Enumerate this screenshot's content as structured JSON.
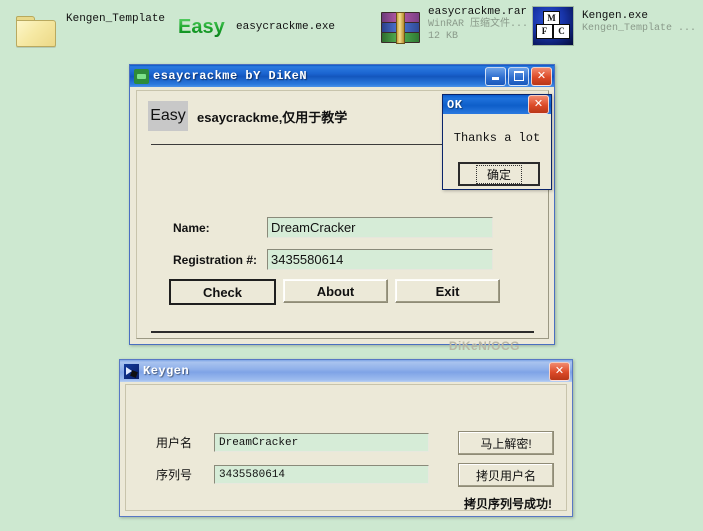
{
  "desktop": {
    "background_color": "#cde8d0",
    "icons": [
      {
        "id": "folder",
        "icon": "folder-icon",
        "title": "Kengen_Template",
        "subtitle": ""
      },
      {
        "id": "easycrackme",
        "icon": "easy-app-icon",
        "logo_text": "Easy",
        "title": "easycrackme.exe",
        "subtitle": ""
      },
      {
        "id": "rar",
        "icon": "winrar-archive-icon",
        "title": "easycrackme.rar",
        "subtitle": "WinRAR 压缩文件...",
        "subtitle2": "12 KB"
      },
      {
        "id": "kengen",
        "icon": "msvc-mfc-icon",
        "cubes": [
          "M",
          "F",
          "C"
        ],
        "title": "Kengen.exe",
        "subtitle": "Kengen_Template ..."
      }
    ]
  },
  "main_window": {
    "title": "esaycrackme bY DiKeN",
    "title_icon": "app-icon",
    "buttons": {
      "minimize": "_",
      "maximize": "□",
      "close": "✕"
    },
    "banner_badge": "Easy",
    "banner_text": "esaycrackme,仅用于教学",
    "fields": [
      {
        "label": "Name:",
        "value": "DreamCracker"
      },
      {
        "label": "Registration #:",
        "value": "3435580614"
      }
    ],
    "actions": [
      {
        "label": "Check",
        "focused": true
      },
      {
        "label": "About",
        "focused": false
      },
      {
        "label": "Exit",
        "focused": false
      }
    ],
    "signature": "DiKeN/OCG"
  },
  "ok_dialog": {
    "title": "OK",
    "close_label": "✕",
    "message": "Thanks a lot",
    "ok_button": "确定"
  },
  "keygen_window": {
    "title": "Keygen",
    "title_icon": "keygen-icon",
    "close_label": "✕",
    "fields": [
      {
        "label": "用户名",
        "value": "DreamCracker"
      },
      {
        "label": "序列号",
        "value": "3435580614"
      }
    ],
    "actions": [
      {
        "label": "马上解密!"
      },
      {
        "label": "拷贝用户名"
      }
    ],
    "status": "拷贝序列号成功!"
  }
}
